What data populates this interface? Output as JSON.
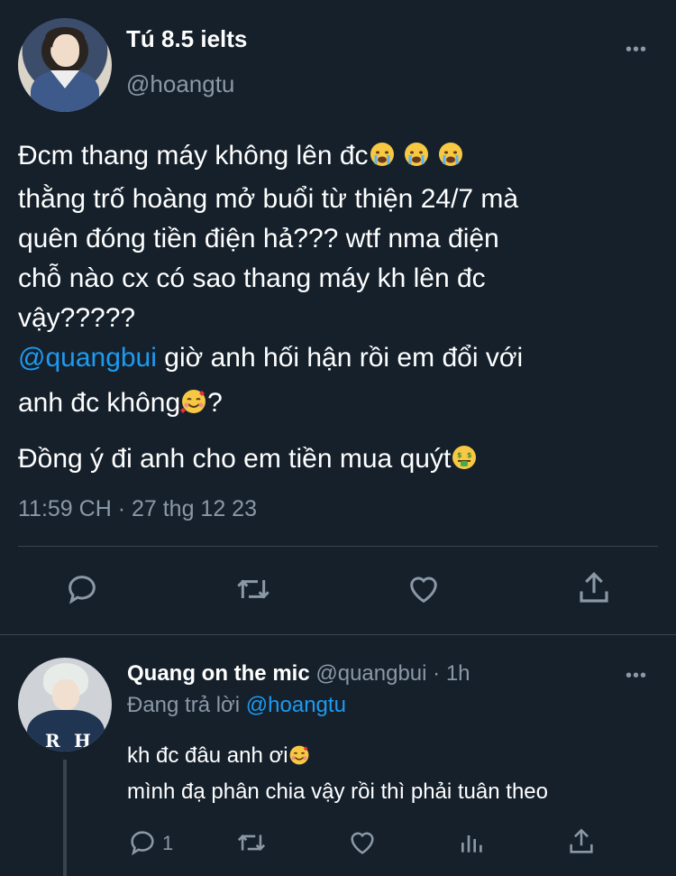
{
  "tweet": {
    "author_name": "Tú 8.5 ielts",
    "author_handle": "@hoangtu",
    "line1": "Đcm thang máy không lên đc",
    "line2": "thằng trố hoàng mở buổi từ thiện 24/7 mà",
    "line3": "quên đóng tiền điện hả??? wtf nma điện",
    "line4": "chỗ nào cx có sao thang máy kh lên đc",
    "line5": "vậy?????",
    "mention": "@quangbui",
    "line6_rest": " giờ anh hối hận rồi em đổi với",
    "line7": "anh đc không",
    "line7_end": "?",
    "line8": "Đồng ý đi anh cho em tiền mua quýt",
    "timestamp": "11:59 CH · 27 thg 12 23",
    "icons": [
      "reply-icon",
      "retweet-icon",
      "like-icon",
      "share-icon"
    ]
  },
  "reply": {
    "author_name": "Quang on the mic",
    "author_handle": "@quangbui",
    "time": "· 1h",
    "replying_prefix": "Đang trả lời ",
    "replying_to": "@hoangtu",
    "line1": "kh đc đâu anh ơi",
    "line2": "mình đạ phân chia vậy rồi thì phải tuân theo",
    "reply_count": "1",
    "icons": [
      "reply-icon",
      "retweet-icon",
      "like-icon",
      "analytics-icon",
      "share-icon"
    ]
  },
  "more_label": "•••",
  "colors": {
    "background": "#15202b",
    "link": "#1d9bf0",
    "muted": "#8b98a5",
    "divider": "#38444d"
  }
}
